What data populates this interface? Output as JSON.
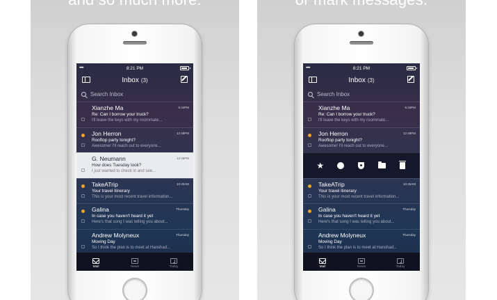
{
  "panels": [
    {
      "caption": "and so much more.",
      "phone": {
        "status": {
          "signal": "•••••",
          "time": "8:21 PM",
          "battery_fraction": 0.85
        },
        "nav": {
          "title": "Inbox",
          "count": "(3)"
        },
        "search": {
          "placeholder": "Search Inbox"
        },
        "messages": [
          {
            "sender": "Xianzhe Ma",
            "time": "5:34PM",
            "subject": "Re: Can I borrow your truck?",
            "preview": "I'll leave the keys with my roommate...",
            "unread": false,
            "highlight": false
          },
          {
            "sender": "Jon Herron",
            "time": "12:48PM",
            "subject": "Rooftop party tonight?",
            "preview": "Awesome! I'll reach out to everyone...",
            "unread": true,
            "highlight": false
          },
          {
            "sender": "G. Neumann",
            "time": "12:48PM",
            "subject": "How does Tuesday look?",
            "preview": "I just wanted to check in and see...",
            "unread": false,
            "highlight": true
          },
          {
            "sender": "TakeATrip",
            "time": "10:45AM",
            "subject": "Your travel itinerary",
            "preview": "This is your most recent travel information...",
            "unread": true,
            "highlight": false
          },
          {
            "sender": "Galina",
            "time": "Thursday",
            "subject": "In case you haven't heard it yet",
            "preview": "Here's that song I was telling you about...",
            "unread": true,
            "highlight": false
          },
          {
            "sender": "Andrew Molyneux",
            "time": "Thursday",
            "subject": "Moving Day",
            "preview": "So I think the plan is to meet at Hanshad...",
            "unread": false,
            "highlight": false
          }
        ],
        "tabs": [
          {
            "label": "Mail",
            "icon": "mail-icon",
            "active": true
          },
          {
            "label": "News",
            "icon": "news-icon",
            "active": false
          },
          {
            "label": "Today",
            "icon": "today-icon",
            "active": false
          }
        ]
      }
    },
    {
      "caption": "or mark messages.",
      "phone": {
        "status": {
          "signal": "•••••",
          "time": "8:21 PM",
          "battery_fraction": 0.85
        },
        "nav": {
          "title": "Inbox",
          "count": "(3)"
        },
        "search": {
          "placeholder": "Search Inbox"
        },
        "messages_top": [
          {
            "sender": "Xianzhe Ma",
            "time": "5:34PM",
            "subject": "Re: Can I borrow your truck?",
            "preview": "I'll leave the keys with my roommate...",
            "unread": false
          },
          {
            "sender": "Jon Herron",
            "time": "12:48PM",
            "subject": "Rooftop party tonight?",
            "preview": "Awesome! I'll reach out to everyone...",
            "unread": true
          }
        ],
        "actions": [
          "star-icon",
          "circle-icon",
          "shield-icon",
          "folder-icon",
          "trash-icon"
        ],
        "messages_bottom": [
          {
            "sender": "TakeATrip",
            "time": "10:45AM",
            "subject": "Your travel itinerary",
            "preview": "This is your most recent travel information...",
            "unread": true
          },
          {
            "sender": "Galina",
            "time": "Thursday",
            "subject": "In case you haven't heard it yet",
            "preview": "Here's that song I was telling you about...",
            "unread": true
          },
          {
            "sender": "Andrew Molyneux",
            "time": "Thursday",
            "subject": "Moving Day",
            "preview": "So I think the plan is to meet at Hanshad...",
            "unread": false
          }
        ],
        "tabs": [
          {
            "label": "Mail",
            "icon": "mail-icon",
            "active": true
          },
          {
            "label": "News",
            "icon": "news-icon",
            "active": false
          },
          {
            "label": "Today",
            "icon": "today-icon",
            "active": false
          }
        ]
      }
    }
  ],
  "colors": {
    "unread_dot": "#f2a422",
    "tab_bar": "#10131f",
    "action_strip": "#15182a"
  }
}
